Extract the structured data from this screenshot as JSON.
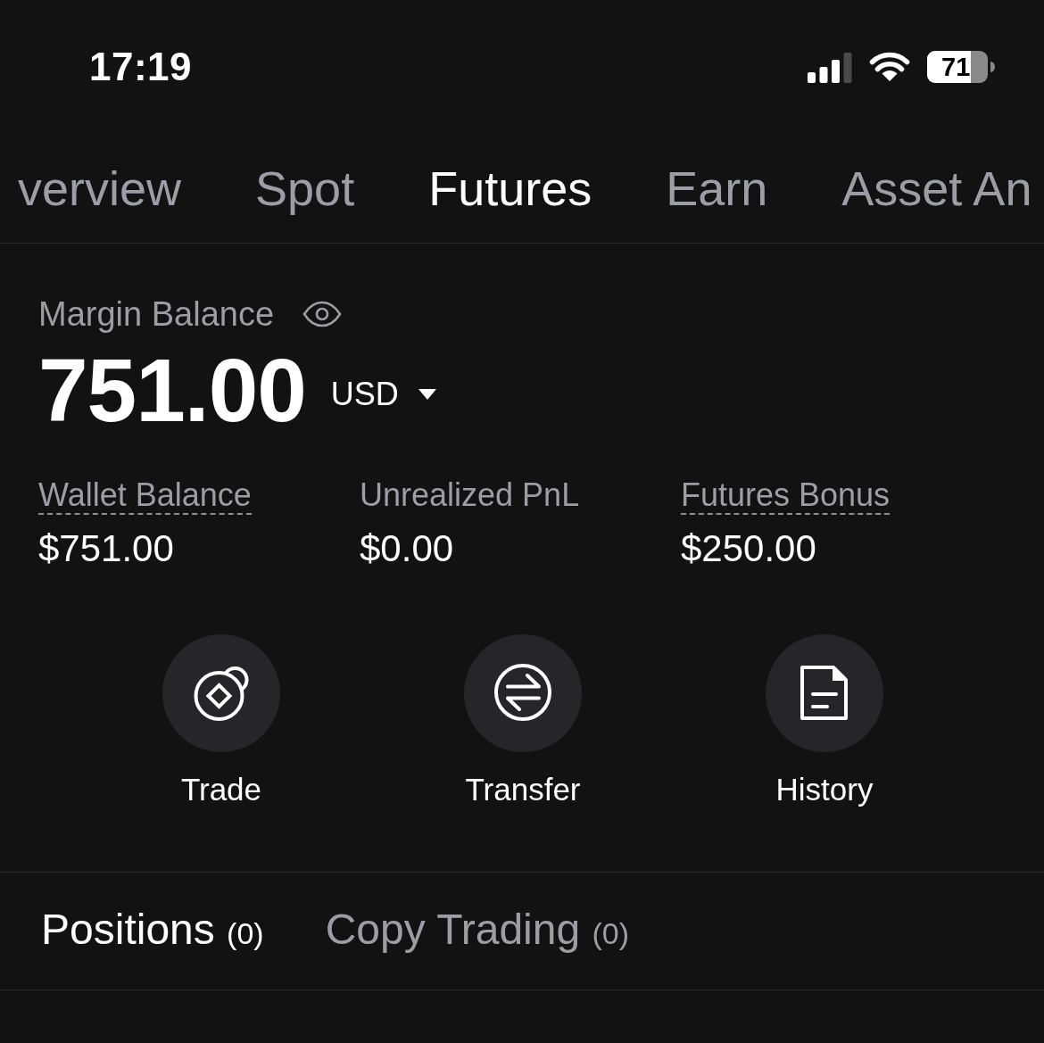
{
  "status_bar": {
    "time": "17:19",
    "battery_text": "71"
  },
  "tabs": [
    {
      "label": "verview",
      "selected": false
    },
    {
      "label": "Spot",
      "selected": false
    },
    {
      "label": "Futures",
      "selected": true
    },
    {
      "label": "Earn",
      "selected": false
    },
    {
      "label": "Asset An",
      "selected": false
    }
  ],
  "balance": {
    "label": "Margin Balance",
    "amount": "751.00",
    "currency": "USD"
  },
  "stats": [
    {
      "label": "Wallet Balance",
      "value": "$751.00",
      "underlined": true
    },
    {
      "label": "Unrealized PnL",
      "value": "$0.00",
      "underlined": false
    },
    {
      "label": "Futures Bonus",
      "value": "$250.00",
      "underlined": true
    }
  ],
  "actions": [
    {
      "kind": "trade",
      "label": "Trade"
    },
    {
      "kind": "transfer",
      "label": "Transfer"
    },
    {
      "kind": "history",
      "label": "History"
    }
  ],
  "sub_tabs": [
    {
      "label": "Positions",
      "count": "(0)",
      "selected": true
    },
    {
      "label": "Copy Trading",
      "count": "(0)",
      "selected": false
    }
  ]
}
